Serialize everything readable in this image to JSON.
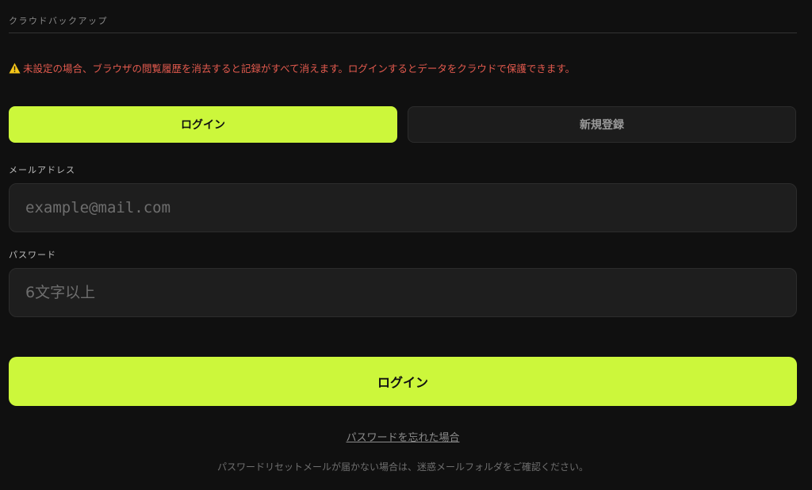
{
  "section": {
    "title": "クラウドバックアップ"
  },
  "warning": {
    "icon": "warning-icon",
    "text": "未設定の場合、ブラウザの閲覧履歴を消去すると記録がすべて消えます。ログインするとデータをクラウドで保護できます。",
    "color": "#e35a4e"
  },
  "tabs": {
    "login_label": "ログイン",
    "register_label": "新規登録",
    "active": "login"
  },
  "form": {
    "email_label": "メールアドレス",
    "email_placeholder": "example@mail.com",
    "email_value": "",
    "password_label": "パスワード",
    "password_placeholder": "6文字以上",
    "password_value": "",
    "submit_label": "ログイン"
  },
  "links": {
    "forgot_password": "パスワードを忘れた場合"
  },
  "note": {
    "text": "パスワードリセットメールが届かない場合は、迷惑メールフォルダをご確認ください。"
  },
  "colors": {
    "accent": "#ccf73b",
    "background": "#101010",
    "field_background": "#1e1e1e"
  }
}
